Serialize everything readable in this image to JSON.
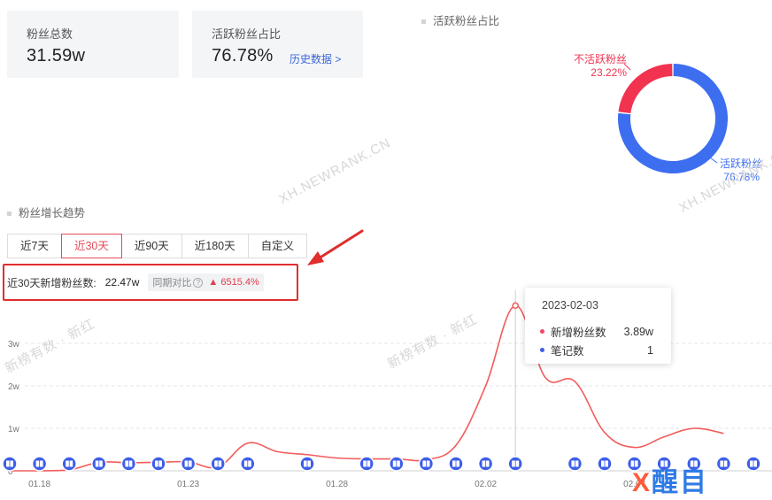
{
  "stats": {
    "fans_total": {
      "label": "粉丝总数",
      "value": "31.59w"
    },
    "active_ratio": {
      "label": "活跃粉丝占比",
      "value": "76.78%",
      "link": "历史数据 >"
    }
  },
  "donut": {
    "title": "活跃粉丝占比",
    "slices": [
      {
        "name": "活跃粉丝",
        "pct_label": "76.78%",
        "value": 76.78,
        "color": "#3d6ef0"
      },
      {
        "name": "不活跃粉丝",
        "pct_label": "23.22%",
        "value": 23.22,
        "color": "#f2334f"
      }
    ]
  },
  "trend": {
    "title": "粉丝增长趋势",
    "tabs": [
      "近7天",
      "近30天",
      "近90天",
      "近180天",
      "自定义"
    ],
    "active_tab": "近30天",
    "summary": {
      "label": "近30天新增粉丝数:",
      "value": "22.47w",
      "yoy_label": "同期对比",
      "yoy_value": "6515.4%"
    }
  },
  "tooltip": {
    "date": "2023-02-03",
    "rows": [
      {
        "name": "新增粉丝数",
        "value": "3.89w",
        "color": "#f04864"
      },
      {
        "name": "笔记数",
        "value": "1",
        "color": "#3d5ee8"
      }
    ]
  },
  "chart_data": {
    "type": "line",
    "x": [
      "01.17",
      "01.18",
      "01.19",
      "01.20",
      "01.21",
      "01.22",
      "01.23",
      "01.24",
      "01.25",
      "01.26",
      "01.27",
      "01.28",
      "01.29",
      "01.30",
      "01.31",
      "02.01",
      "02.02",
      "02.03",
      "02.04",
      "02.05",
      "02.06",
      "02.07",
      "02.08",
      "02.09",
      "02.10"
    ],
    "x_tick_labels": [
      "01.18",
      "01.23",
      "01.28",
      "02.02",
      "02.07"
    ],
    "y_tick_labels": [
      "0",
      "1w",
      "2w",
      "3w"
    ],
    "ylim": [
      0,
      40000
    ],
    "series": [
      {
        "name": "新增粉丝数",
        "color": "#f25c5c",
        "values": [
          0,
          0,
          200,
          2000,
          1900,
          2000,
          2100,
          900,
          6500,
          4500,
          3800,
          3000,
          2800,
          2800,
          2600,
          6000,
          20000,
          38900,
          22000,
          21000,
          9000,
          5500,
          8000,
          10000,
          8800
        ]
      },
      {
        "name": "笔记数",
        "color": "#3d5ee8",
        "marker_dates": [
          "01.17",
          "01.18",
          "01.19",
          "01.20",
          "01.21",
          "01.22",
          "01.23",
          "01.24",
          "01.25",
          "01.27",
          "01.29",
          "01.30",
          "01.31",
          "02.01",
          "02.02",
          "02.03",
          "02.05",
          "02.06",
          "02.07",
          "02.08",
          "02.09",
          "02.10",
          "02.11",
          "02.12"
        ]
      }
    ],
    "tooltip_x": "02.03"
  },
  "watermarks": [
    "XH.NEWRANK.CN",
    "XH.NEWRANK.CN",
    "新榜有数 · 新红",
    "新榜有数 · 新红"
  ],
  "logo": {
    "x": "X",
    "text": "醒目"
  }
}
